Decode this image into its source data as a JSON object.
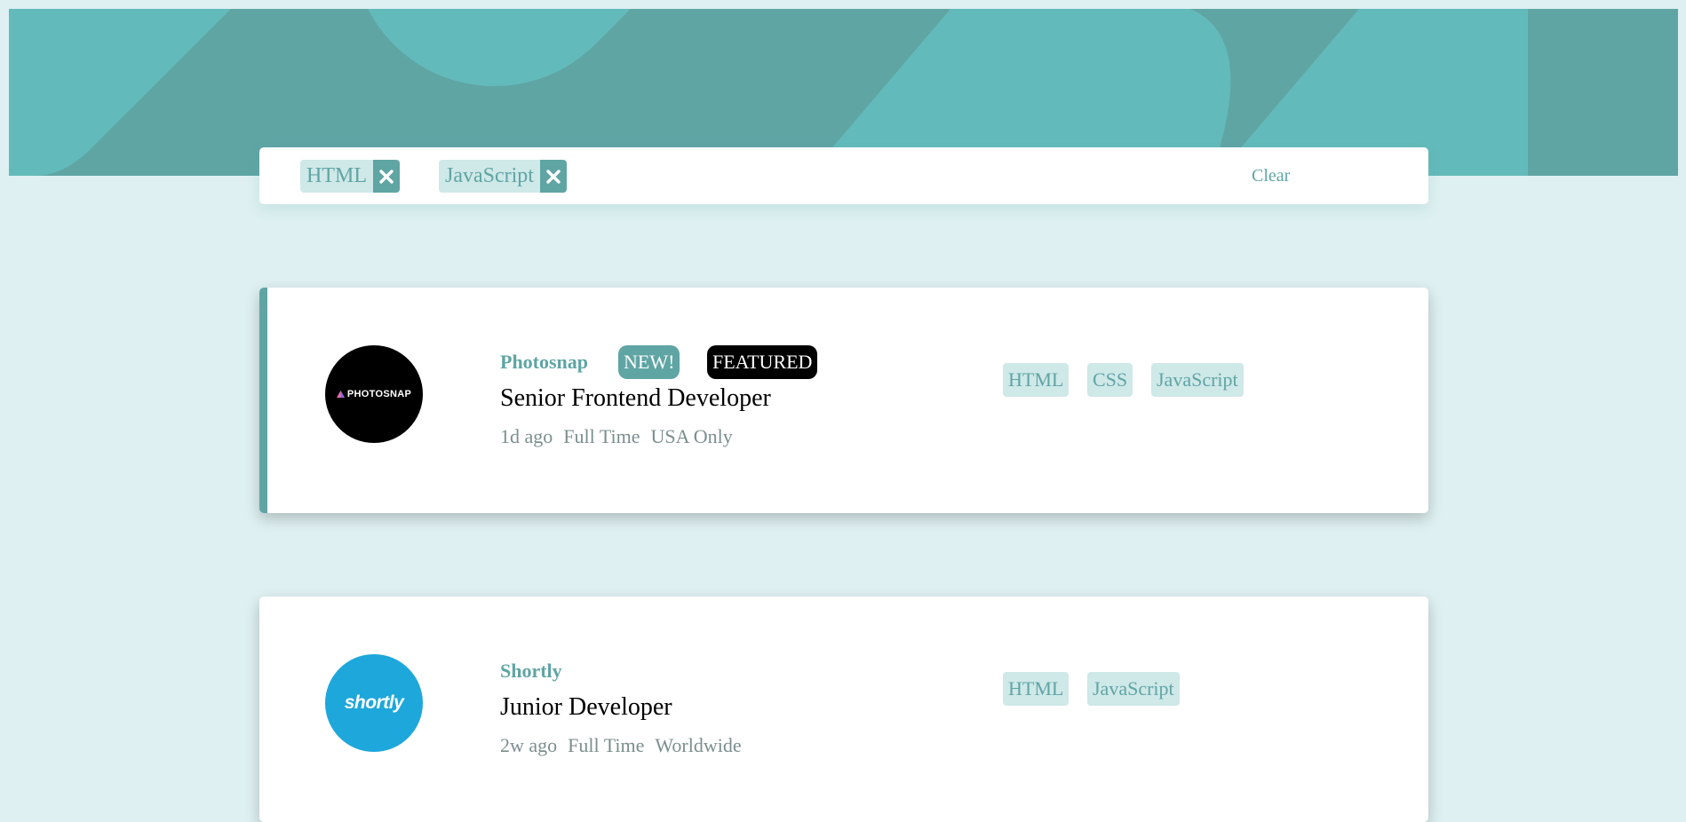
{
  "filters": {
    "chips": [
      {
        "label": "HTML"
      },
      {
        "label": "JavaScript"
      }
    ],
    "clear_label": "Clear"
  },
  "jobs": [
    {
      "company": "Photosnap",
      "logo_text": "PHOTOSNAP",
      "new_label": "NEW!",
      "featured_label": "FEATURED",
      "position": "Senior Frontend Developer",
      "posted": "1d ago",
      "contract": "Full Time",
      "location": "USA Only",
      "tags": [
        "HTML",
        "CSS",
        "JavaScript"
      ],
      "logo_color": "#000000"
    },
    {
      "company": "Shortly",
      "logo_text": "shortly",
      "position": "Junior Developer",
      "posted": "2w ago",
      "contract": "Full Time",
      "location": "Worldwide",
      "tags": [
        "HTML",
        "JavaScript"
      ],
      "logo_color": "#1ea7db"
    }
  ],
  "colors": {
    "accent": "#5fa5a4",
    "background": "#def0f1",
    "tag_background": "#cfe8e8",
    "header_light": "#63baba"
  }
}
